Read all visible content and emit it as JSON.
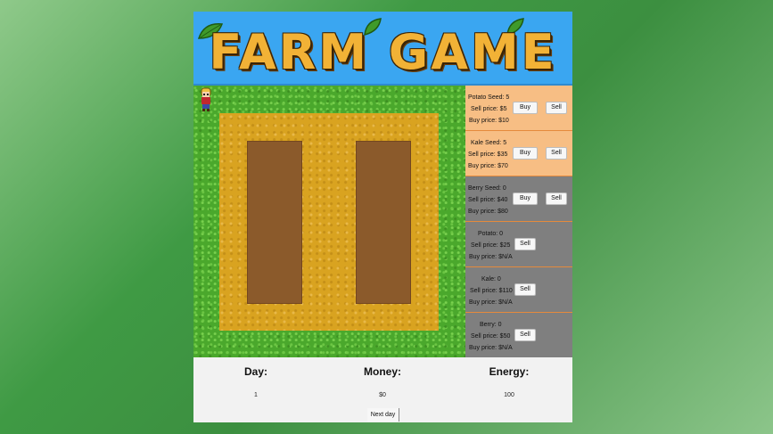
{
  "title": "FARM GAME",
  "colors": {
    "banner": "#3aa6f1",
    "grass": "#4aa82c",
    "tilled_plot": "#d9a320",
    "soil_bed": "#8b5a2b",
    "shop_available": "#f7be84",
    "shop_locked": "#7f7f7f"
  },
  "shop": {
    "items": [
      {
        "name_line": "Potato Seed: 5",
        "sell_line": "Sell price: $5",
        "buy_line": "Buy price: $10",
        "buy_label": "Buy",
        "sell_label": "Sell",
        "state": "available"
      },
      {
        "name_line": "Kale Seed: 5",
        "sell_line": "Sell price: $35",
        "buy_line": "Buy price: $70",
        "buy_label": "Buy",
        "sell_label": "Sell",
        "state": "available"
      },
      {
        "name_line": "Berry Seed: 0",
        "sell_line": "Sell price: $40",
        "buy_line": "Buy price: $80",
        "buy_label": "Buy",
        "sell_label": "Sell",
        "state": "locked"
      },
      {
        "name_line": "Potato: 0",
        "sell_line": "Sell price: $25",
        "buy_line": "Buy price: $N/A",
        "sell_label": "Sell",
        "state": "locked"
      },
      {
        "name_line": "Kale: 0",
        "sell_line": "Sell price: $110",
        "buy_line": "Buy price: $N/A",
        "sell_label": "Sell",
        "state": "locked"
      },
      {
        "name_line": "Berry: 0",
        "sell_line": "Sell price: $50",
        "buy_line": "Buy price: $N/A",
        "sell_label": "Sell",
        "state": "locked"
      }
    ]
  },
  "status": {
    "day_label": "Day:",
    "day_value": "1",
    "money_label": "Money:",
    "money_value": "$0",
    "energy_label": "Energy:",
    "energy_value": "100",
    "next_day_label": "Next day"
  }
}
